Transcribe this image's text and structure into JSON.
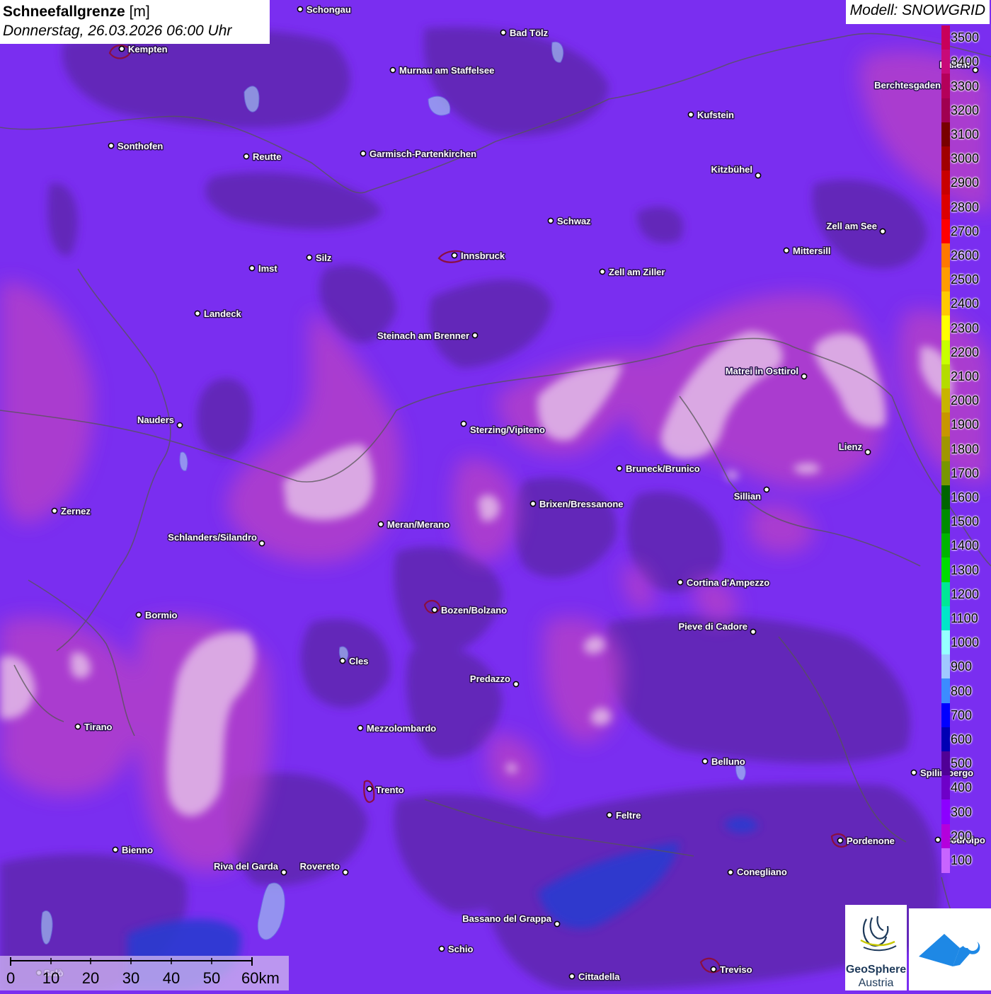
{
  "header": {
    "title_bold": "Schneefallgrenze",
    "title_unit": " [m]",
    "datetime": "Donnerstag, 26.03.2026 06:00 Uhr",
    "model": "Modell: SNOWGRID"
  },
  "legend": {
    "labels": [
      "3500",
      "3400",
      "3300",
      "3200",
      "3100",
      "3000",
      "2900",
      "2800",
      "2700",
      "2600",
      "2500",
      "2400",
      "2300",
      "2200",
      "2100",
      "2000",
      "1900",
      "1800",
      "1700",
      "1600",
      "1500",
      "1400",
      "1300",
      "1200",
      "1100",
      "1000",
      "900",
      "800",
      "700",
      "600",
      "500",
      "400",
      "300",
      "200",
      "100"
    ],
    "colors": [
      "#c8005a",
      "#c80a78",
      "#b4005a",
      "#a00050",
      "#780000",
      "#a00000",
      "#c80000",
      "#dc0000",
      "#ff0000",
      "#ff7800",
      "#ff9c00",
      "#ffc800",
      "#ffff00",
      "#c8ff00",
      "#b4dc00",
      "#c8b400",
      "#c89600",
      "#a09600",
      "#789600",
      "#006400",
      "#008c00",
      "#00b400",
      "#00dc00",
      "#00e696",
      "#00e6c8",
      "#96ffff",
      "#a0c8ff",
      "#3c8cff",
      "#0000ff",
      "#0000b4",
      "#500096",
      "#6e00c8",
      "#8c00ff",
      "#b400dc",
      "#c864ff"
    ]
  },
  "cities": [
    {
      "name": "Schongau",
      "dot": [
        424,
        13
      ],
      "label": [
        433,
        18
      ],
      "anchor": "start"
    },
    {
      "name": "Kempten",
      "dot": [
        172,
        69
      ],
      "label": [
        181,
        74
      ],
      "anchor": "start"
    },
    {
      "name": "Bad Tölz",
      "dot": [
        711,
        46
      ],
      "label": [
        720,
        51
      ],
      "anchor": "start"
    },
    {
      "name": "Murnau am Staffelsee",
      "dot": [
        555,
        99
      ],
      "label": [
        564,
        104
      ],
      "anchor": "start"
    },
    {
      "name": "Hallein",
      "dot": [
        1378,
        99
      ],
      "label": [
        1370,
        96
      ],
      "anchor": "end"
    },
    {
      "name": "Berchtesgaden",
      "dot": [
        1337,
        120
      ],
      "label": [
        1329,
        125
      ],
      "anchor": "end"
    },
    {
      "name": "Kufstein",
      "dot": [
        976,
        162
      ],
      "label": [
        985,
        167
      ],
      "anchor": "start"
    },
    {
      "name": "Sonthofen",
      "dot": [
        157,
        206
      ],
      "label": [
        166,
        211
      ],
      "anchor": "start"
    },
    {
      "name": "Reutte",
      "dot": [
        348,
        221
      ],
      "label": [
        357,
        226
      ],
      "anchor": "start"
    },
    {
      "name": "Garmisch-Partenkirchen",
      "dot": [
        513,
        217
      ],
      "label": [
        522,
        222
      ],
      "anchor": "start"
    },
    {
      "name": "Kitzbühel",
      "dot": [
        1071,
        248
      ],
      "label": [
        1063,
        244
      ],
      "anchor": "end"
    },
    {
      "name": "Schwaz",
      "dot": [
        778,
        312
      ],
      "label": [
        787,
        317
      ],
      "anchor": "start"
    },
    {
      "name": "Zell am See",
      "dot": [
        1247,
        327
      ],
      "label": [
        1239,
        324
      ],
      "anchor": "end"
    },
    {
      "name": "Mittersill",
      "dot": [
        1111,
        354
      ],
      "label": [
        1120,
        359
      ],
      "anchor": "start"
    },
    {
      "name": "Innsbruck",
      "dot": [
        642,
        361
      ],
      "label": [
        651,
        366
      ],
      "anchor": "start"
    },
    {
      "name": "Silz",
      "dot": [
        437,
        364
      ],
      "label": [
        446,
        369
      ],
      "anchor": "start"
    },
    {
      "name": "Imst",
      "dot": [
        356,
        379
      ],
      "label": [
        365,
        384
      ],
      "anchor": "start"
    },
    {
      "name": "Zell am Ziller",
      "dot": [
        851,
        384
      ],
      "label": [
        860,
        389
      ],
      "anchor": "start"
    },
    {
      "name": "Landeck",
      "dot": [
        279,
        443
      ],
      "label": [
        288,
        448
      ],
      "anchor": "start"
    },
    {
      "name": "Steinach am Brenner",
      "dot": [
        671,
        474
      ],
      "label": [
        663,
        479
      ],
      "anchor": "end"
    },
    {
      "name": "Matrei in Osttirol",
      "dot": [
        1136,
        532
      ],
      "label": [
        1128,
        529
      ],
      "anchor": "end"
    },
    {
      "name": "Nauders",
      "dot": [
        254,
        601
      ],
      "label": [
        246,
        598
      ],
      "anchor": "end"
    },
    {
      "name": "Sterzing/Vipiteno",
      "dot": [
        655,
        599
      ],
      "label": [
        664,
        612
      ],
      "anchor": "start"
    },
    {
      "name": "Lienz",
      "dot": [
        1226,
        639
      ],
      "label": [
        1218,
        636
      ],
      "anchor": "end"
    },
    {
      "name": "Bruneck/Brunico",
      "dot": [
        875,
        662
      ],
      "label": [
        884,
        667
      ],
      "anchor": "start"
    },
    {
      "name": "Sillian",
      "dot": [
        1083,
        692
      ],
      "label": [
        1075,
        706
      ],
      "anchor": "end"
    },
    {
      "name": "Brixen/Bressanone",
      "dot": [
        753,
        712
      ],
      "label": [
        762,
        717
      ],
      "anchor": "start"
    },
    {
      "name": "Zernez",
      "dot": [
        77,
        722
      ],
      "label": [
        86,
        727
      ],
      "anchor": "start"
    },
    {
      "name": "Meran/Merano",
      "dot": [
        538,
        741
      ],
      "label": [
        547,
        746
      ],
      "anchor": "start"
    },
    {
      "name": "Schlanders/Silandro",
      "dot": [
        370,
        768
      ],
      "label": [
        363,
        764
      ],
      "anchor": "end"
    },
    {
      "name": "Cortina d'Ampezzo",
      "dot": [
        961,
        823
      ],
      "label": [
        970,
        828
      ],
      "anchor": "start"
    },
    {
      "name": "Bozen/Bolzano",
      "dot": [
        614,
        862
      ],
      "label": [
        623,
        867
      ],
      "anchor": "start"
    },
    {
      "name": "Bormio",
      "dot": [
        196,
        869
      ],
      "label": [
        205,
        874
      ],
      "anchor": "start"
    },
    {
      "name": "Pieve di Cadore",
      "dot": [
        1064,
        893
      ],
      "label": [
        1056,
        890
      ],
      "anchor": "end"
    },
    {
      "name": "Cles",
      "dot": [
        484,
        934
      ],
      "label": [
        493,
        939
      ],
      "anchor": "start"
    },
    {
      "name": "Predazzo",
      "dot": [
        729,
        967
      ],
      "label": [
        721,
        964
      ],
      "anchor": "end"
    },
    {
      "name": "Tirano",
      "dot": [
        110,
        1027
      ],
      "label": [
        119,
        1032
      ],
      "anchor": "start"
    },
    {
      "name": "Mezzolombardo",
      "dot": [
        509,
        1029
      ],
      "label": [
        518,
        1034
      ],
      "anchor": "start"
    },
    {
      "name": "Belluno",
      "dot": [
        996,
        1076
      ],
      "label": [
        1005,
        1081
      ],
      "anchor": "start"
    },
    {
      "name": "Spilimbergo",
      "dot": [
        1291,
        1092
      ],
      "label": [
        1300,
        1097
      ],
      "anchor": "start"
    },
    {
      "name": "Trento",
      "dot": [
        522,
        1115
      ],
      "label": [
        531,
        1121
      ],
      "anchor": "start"
    },
    {
      "name": "Feltre",
      "dot": [
        861,
        1152
      ],
      "label": [
        870,
        1157
      ],
      "anchor": "start"
    },
    {
      "name": "Pordenone",
      "dot": [
        1187,
        1188
      ],
      "label": [
        1196,
        1193
      ],
      "anchor": "start"
    },
    {
      "name": "Codroipo",
      "dot": [
        1325,
        1187
      ],
      "label": [
        1334,
        1192
      ],
      "anchor": "start"
    },
    {
      "name": "Bienno",
      "dot": [
        163,
        1201
      ],
      "label": [
        172,
        1206
      ],
      "anchor": "start"
    },
    {
      "name": "Riva del Garda",
      "dot": [
        401,
        1233
      ],
      "label": [
        393,
        1229
      ],
      "anchor": "end"
    },
    {
      "name": "Rovereto",
      "dot": [
        488,
        1233
      ],
      "label": [
        480,
        1229
      ],
      "anchor": "end"
    },
    {
      "name": "Conegliano",
      "dot": [
        1032,
        1233
      ],
      "label": [
        1041,
        1237
      ],
      "anchor": "start"
    },
    {
      "name": "Bassano del Grappa",
      "dot": [
        787,
        1306
      ],
      "label": [
        779,
        1303
      ],
      "anchor": "end"
    },
    {
      "name": "Schio",
      "dot": [
        624,
        1341
      ],
      "label": [
        633,
        1346
      ],
      "anchor": "start"
    },
    {
      "name": "Treviso",
      "dot": [
        1008,
        1370
      ],
      "label": [
        1017,
        1375
      ],
      "anchor": "start"
    },
    {
      "name": "Cittadella",
      "dot": [
        808,
        1380
      ],
      "label": [
        817,
        1385
      ],
      "anchor": "start"
    },
    {
      "name": "Salò",
      "dot": [
        55,
        1375
      ],
      "label": [
        62,
        1380
      ],
      "anchor": "start"
    }
  ],
  "scalebar": {
    "labels": [
      "0",
      "10",
      "20",
      "30",
      "40",
      "50",
      "60km"
    ]
  },
  "logos": {
    "geosphere_line1": "GeoSphere",
    "geosphere_line2": "Austria"
  },
  "colors": {
    "base": "#7a2ef0",
    "dark_region": "#5e25b0",
    "magenta_region": "#b640c8",
    "light_region": "#e0b4e6",
    "blue_region": "#2a3ad0",
    "border": "#555555",
    "app_logo_blue": "#1e88e5"
  }
}
